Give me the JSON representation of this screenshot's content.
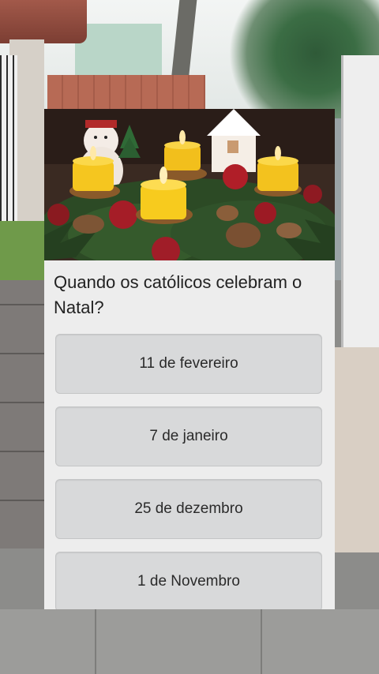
{
  "quiz": {
    "question": "Quando os católicos celebram o Natal?",
    "image_description": "advent-wreath-with-candles",
    "options": [
      {
        "label": "11 de fevereiro"
      },
      {
        "label": "7 de janeiro"
      },
      {
        "label": "25 de dezembro"
      },
      {
        "label": "1 de Novembro"
      }
    ]
  },
  "colors": {
    "card_bg": "#ededed",
    "option_bg": "#d8d9da",
    "text": "#222222",
    "candle": "#f5c61f",
    "ornament_red": "#b01e28",
    "pine_green": "#2c4a25"
  }
}
